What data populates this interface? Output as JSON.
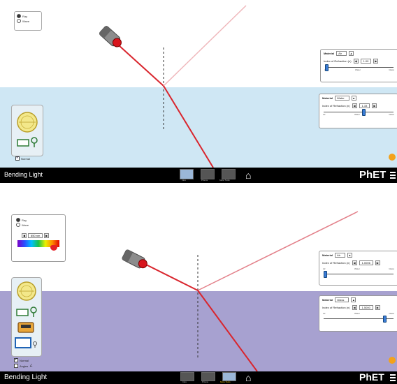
{
  "app_title": "Bending Light",
  "brand": {
    "ph": "PhET",
    "accent": "#f0c000"
  },
  "nav": {
    "screens": [
      "Intro",
      "Prisms",
      "More Tools"
    ],
    "home_icon": "home-icon",
    "menu_icon": "hamburger-menu-icon"
  },
  "colors": {
    "air_bg": "#ffffff",
    "water_bg": "#cfe7f4",
    "glass_bg": "#a7a1d0",
    "laser_beam": "#d9252d"
  },
  "top_panel": {
    "mode_options": [
      "Ray",
      "Wave"
    ],
    "selected_mode": "Ray",
    "upper_material": {
      "label": "Material",
      "value": "Air",
      "ior_label": "Index of Refraction (n)",
      "ior_value": "1.00",
      "tick_labels": [
        "Air",
        "Water",
        "Glass"
      ],
      "slider_fraction": 0.0
    },
    "lower_material": {
      "label": "Material",
      "value": "Water",
      "ior_label": "Index of Refraction (n)",
      "ior_value": "1.33",
      "tick_labels": [
        "Air",
        "Water",
        "Glass"
      ],
      "slider_fraction": 0.55
    },
    "normal_checkbox": {
      "label": "Normal",
      "checked": true
    },
    "tools": [
      "protractor-icon",
      "intensity-meter-icon"
    ]
  },
  "bottom_panel": {
    "mode_options": [
      "Ray",
      "Wave"
    ],
    "selected_mode": "Ray",
    "wavelength": {
      "value": "650 nm"
    },
    "upper_material": {
      "label": "Material",
      "value": "Air",
      "ior_label": "Index of Refraction (n)",
      "ior_value": "1.0006",
      "tick_labels": [
        "Air",
        "Water",
        "Glass"
      ],
      "slider_fraction": 0.0
    },
    "lower_material": {
      "label": "Material",
      "value": "Glass",
      "ior_label": "Index of Refraction (n)",
      "ior_value": "1.5000",
      "tick_labels": [
        "Air",
        "Water",
        "Glass"
      ],
      "slider_fraction": 0.85
    },
    "normal_checkbox": {
      "label": "Normal",
      "checked": true
    },
    "angles_checkbox": {
      "label": "Angles",
      "checked": false
    },
    "tools": [
      "protractor-icon",
      "intensity-meter-icon",
      "velocity-sensor-icon",
      "wave-sensor-icon"
    ]
  }
}
